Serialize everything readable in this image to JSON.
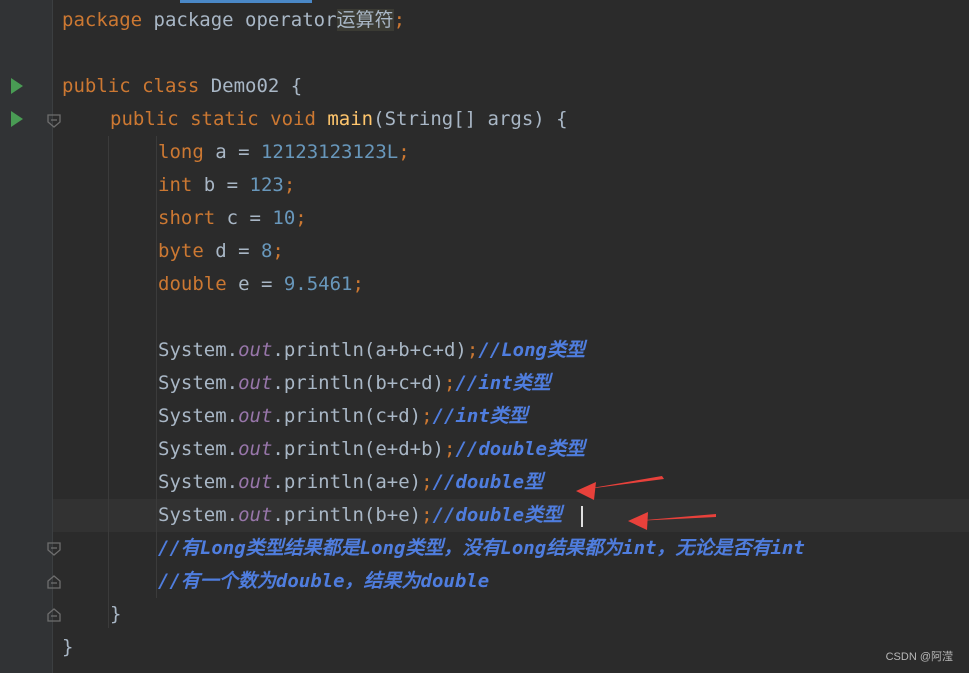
{
  "editor": {
    "lines": [
      {
        "text_pre": "package operator",
        "text_cn": "运算符",
        "semicolon": ";"
      },
      {
        "kw1": "public ",
        "kw2": "class ",
        "name": "Demo02 {"
      },
      {
        "kw1": "public ",
        "kw2": "static ",
        "kw3": "void ",
        "fn": "main",
        "rest": "(String[] args) {"
      },
      {
        "type": "long",
        "decl": " a = ",
        "value": "12123123123L",
        "semi": ";"
      },
      {
        "type": "int",
        "decl": " b = ",
        "value": "123",
        "semi": ";"
      },
      {
        "type": "short",
        "decl": " c = ",
        "value": "10",
        "semi": ";"
      },
      {
        "type": "byte",
        "decl": " d = ",
        "value": "8",
        "semi": ";"
      },
      {
        "type": "double",
        "decl": " e = ",
        "value": "9.5461",
        "semi": ";"
      },
      {
        "sys": "System.",
        "out": "out",
        "call": ".println(a+b+c+d)",
        "semi": ";",
        "comment": "//Long类型"
      },
      {
        "sys": "System.",
        "out": "out",
        "call": ".println(b+c+d)",
        "semi": ";",
        "comment": "//int类型"
      },
      {
        "sys": "System.",
        "out": "out",
        "call": ".println(c+d)",
        "semi": ";",
        "comment": "//int类型"
      },
      {
        "sys": "System.",
        "out": "out",
        "call": ".println(e+d+b)",
        "semi": ";",
        "comment": "//double类型"
      },
      {
        "sys": "System.",
        "out": "out",
        "call": ".println(a+e)",
        "semi": ";",
        "comment": "//double型"
      },
      {
        "sys": "System.",
        "out": "out",
        "call": ".println(b+e)",
        "semi": ";",
        "comment": "//double类型"
      },
      {
        "comment": "//有Long类型结果都是Long类型，没有Long结果都为int，无论是否有int"
      },
      {
        "comment": "//有一个数为double，结果为double"
      },
      {
        "brace": "}"
      },
      {
        "brace": "}"
      }
    ]
  },
  "annotation_color": "#e8413b",
  "watermark": "CSDN @阿滢"
}
